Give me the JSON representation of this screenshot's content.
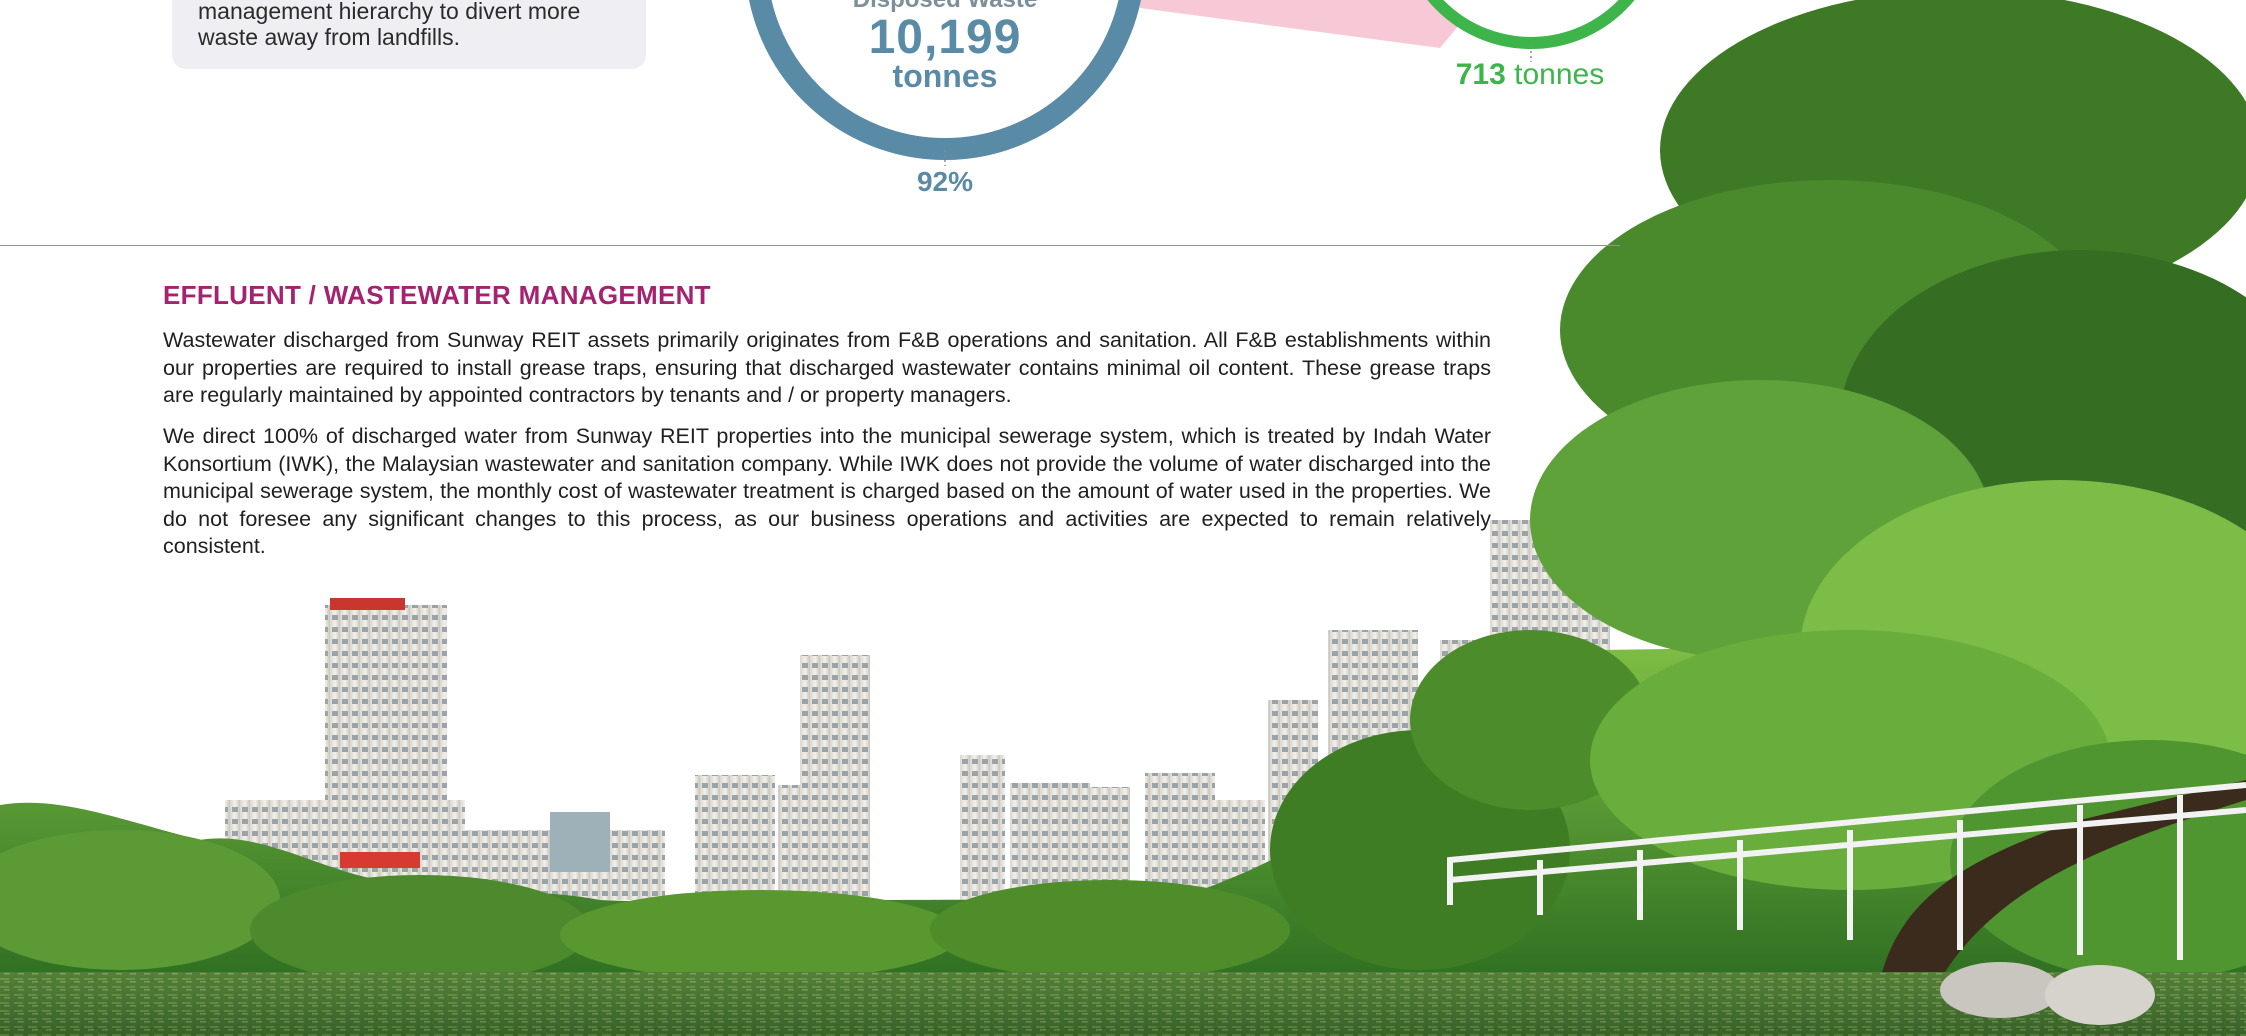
{
  "waste_summary": {
    "callout_text": "management hierarchy to divert more waste away from landfills.",
    "disposed_label": "Disposed Waste",
    "disposed_value": "10,199",
    "disposed_unit": "tonnes",
    "disposed_percent": "92%",
    "diverted_value": "713",
    "diverted_unit": "tonnes",
    "colors": {
      "disposed_ring": "#5a8ba6",
      "diverted_ring": "#3db54a",
      "connector": "#f7c9d6"
    }
  },
  "article": {
    "title": "EFFLUENT / WASTEWATER MANAGEMENT",
    "title_color": "#a4226f",
    "paragraphs": [
      "Wastewater discharged from Sunway REIT assets primarily originates from F&B operations and sanitation. All F&B establishments within our properties are required to install grease traps, ensuring that discharged wastewater contains minimal oil content. These grease traps are regularly maintained by appointed contractors by tenants and / or property managers.",
      "We direct 100% of discharged water from Sunway REIT properties into the municipal sewerage system, which is treated by Indah Water Konsortium (IWK), the Malaysian wastewater and sanitation company. While IWK does not provide the volume of water discharged into the municipal sewerage system, the monthly cost of wastewater treatment is charged based on the amount of water used in the properties. We do not foresee any significant changes to this process, as our business operations and activities are expected to remain relatively consistent."
    ]
  },
  "photo": {
    "icon": "lakeside-city-skyline-illustration"
  }
}
